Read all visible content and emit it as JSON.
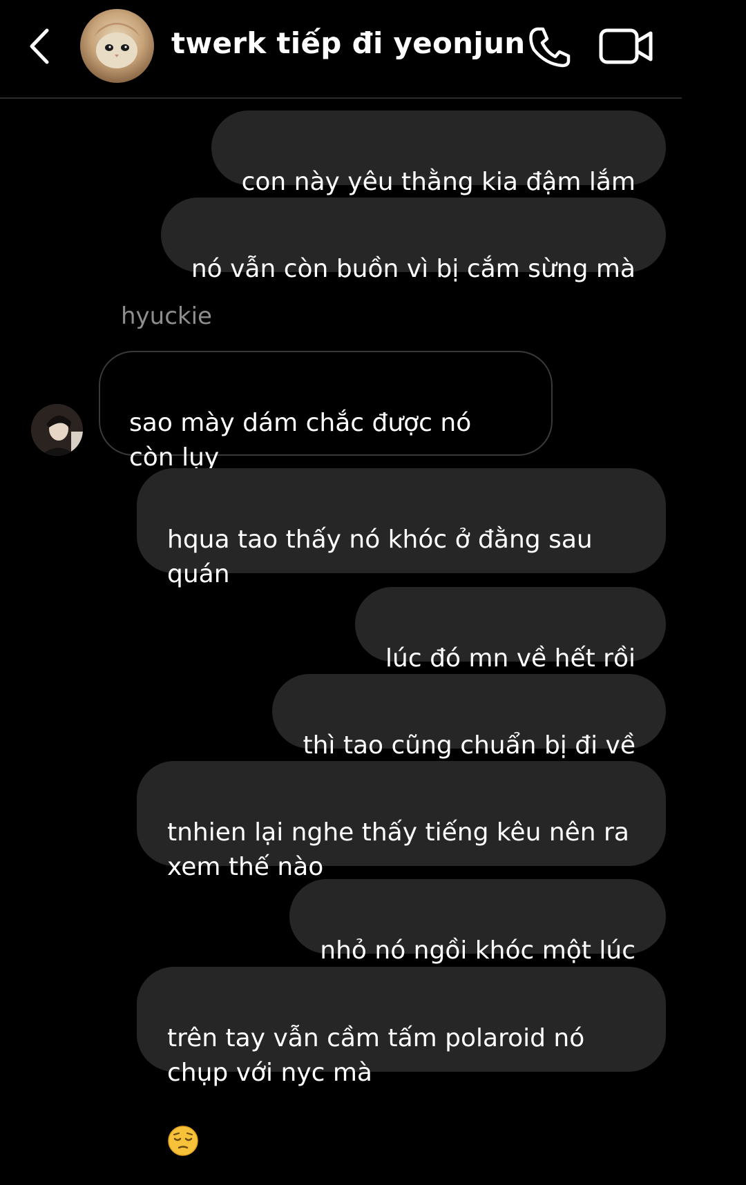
{
  "header": {
    "title": "twerk tiếp đi yeonjun",
    "back_icon": "chevron-left-icon",
    "call_icon": "phone-icon",
    "video_icon": "video-camera-icon"
  },
  "messages": [
    {
      "side": "out",
      "text": "con này yêu thằng kia đậm lắm"
    },
    {
      "side": "out",
      "text": "nó vẫn còn buồn vì bị cắm sừng mà"
    },
    {
      "side": "in",
      "sender": "hyuckie",
      "text": "sao mày dám chắc được nó\ncòn lụy"
    },
    {
      "side": "out",
      "text": "hqua tao thấy nó khóc ở đằng sau\nquán"
    },
    {
      "side": "out",
      "text": "lúc đó mn về hết rồi"
    },
    {
      "side": "out",
      "text": "thì tao cũng chuẩn bị đi về"
    },
    {
      "side": "out",
      "text": "tnhien lại nghe thấy tiếng kêu nên ra\nxem thế nào"
    },
    {
      "side": "out",
      "text": "nhỏ nó ngồi khóc một lúc"
    },
    {
      "side": "out",
      "text": "trên tay vẫn cầm tấm polaroid nó\nchụp với nyc mà",
      "emoji": "pensive-face-emoji"
    }
  ],
  "colors": {
    "background": "#000000",
    "outgoing_bubble": "#262626",
    "incoming_border": "#3a3a3a",
    "sender_name": "#8e8e8e",
    "text": "#ffffff"
  }
}
